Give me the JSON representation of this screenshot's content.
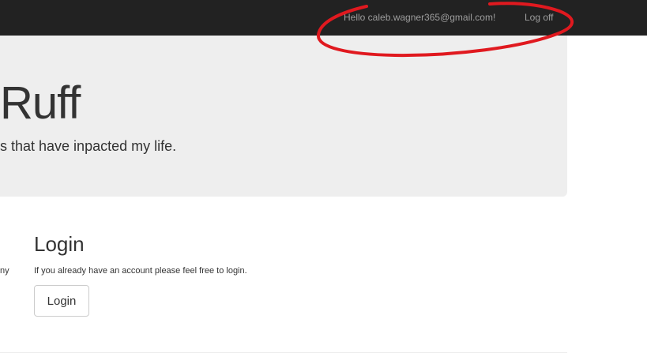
{
  "navbar": {
    "greeting": "Hello caleb.wagner365@gmail.com!",
    "logoff_label": "Log off"
  },
  "hero": {
    "title_fragment": "Ruff",
    "subtitle_fragment": "s that have inpacted my life."
  },
  "left_column": {
    "text_fragment": "ny"
  },
  "login_section": {
    "heading": "Login",
    "description": "If you already have an account please feel free to login.",
    "button_label": "Login"
  },
  "annotation": {
    "shape": "freehand ellipse",
    "color": "#e0191f"
  }
}
